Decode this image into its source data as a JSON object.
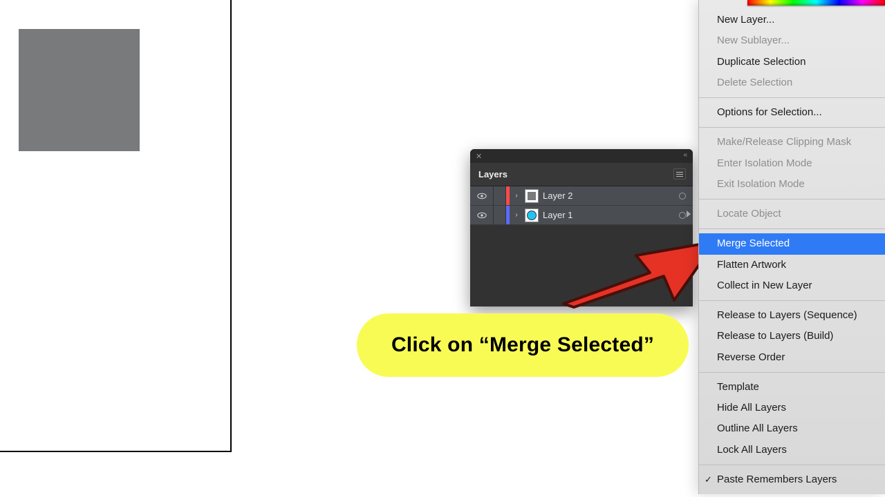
{
  "canvas": {
    "shape": "gray-rectangle"
  },
  "layers_panel": {
    "title": "Layers",
    "rows": [
      {
        "name": "Layer 2",
        "color": "#ff4a4a",
        "thumb": "gray"
      },
      {
        "name": "Layer 1",
        "color": "#5a6bff",
        "thumb": "circle"
      }
    ]
  },
  "context_menu": {
    "sections": [
      [
        {
          "label": "New Layer...",
          "enabled": true
        },
        {
          "label": "New Sublayer...",
          "enabled": false
        },
        {
          "label": "Duplicate Selection",
          "enabled": true
        },
        {
          "label": "Delete Selection",
          "enabled": false
        }
      ],
      [
        {
          "label": "Options for Selection...",
          "enabled": true
        }
      ],
      [
        {
          "label": "Make/Release Clipping Mask",
          "enabled": false
        },
        {
          "label": "Enter Isolation Mode",
          "enabled": false
        },
        {
          "label": "Exit Isolation Mode",
          "enabled": false
        }
      ],
      [
        {
          "label": "Locate Object",
          "enabled": false
        }
      ],
      [
        {
          "label": "Merge Selected",
          "enabled": true,
          "highlighted": true
        },
        {
          "label": "Flatten Artwork",
          "enabled": true
        },
        {
          "label": "Collect in New Layer",
          "enabled": true
        }
      ],
      [
        {
          "label": "Release to Layers (Sequence)",
          "enabled": true
        },
        {
          "label": "Release to Layers (Build)",
          "enabled": true
        },
        {
          "label": "Reverse Order",
          "enabled": true
        }
      ],
      [
        {
          "label": "Template",
          "enabled": true
        },
        {
          "label": "Hide All Layers",
          "enabled": true
        },
        {
          "label": "Outline All Layers",
          "enabled": true
        },
        {
          "label": "Lock All Layers",
          "enabled": true
        }
      ],
      [
        {
          "label": "Paste Remembers Layers",
          "enabled": true,
          "checked": true
        }
      ]
    ]
  },
  "callout": {
    "text": "Click on “Merge Selected”"
  }
}
